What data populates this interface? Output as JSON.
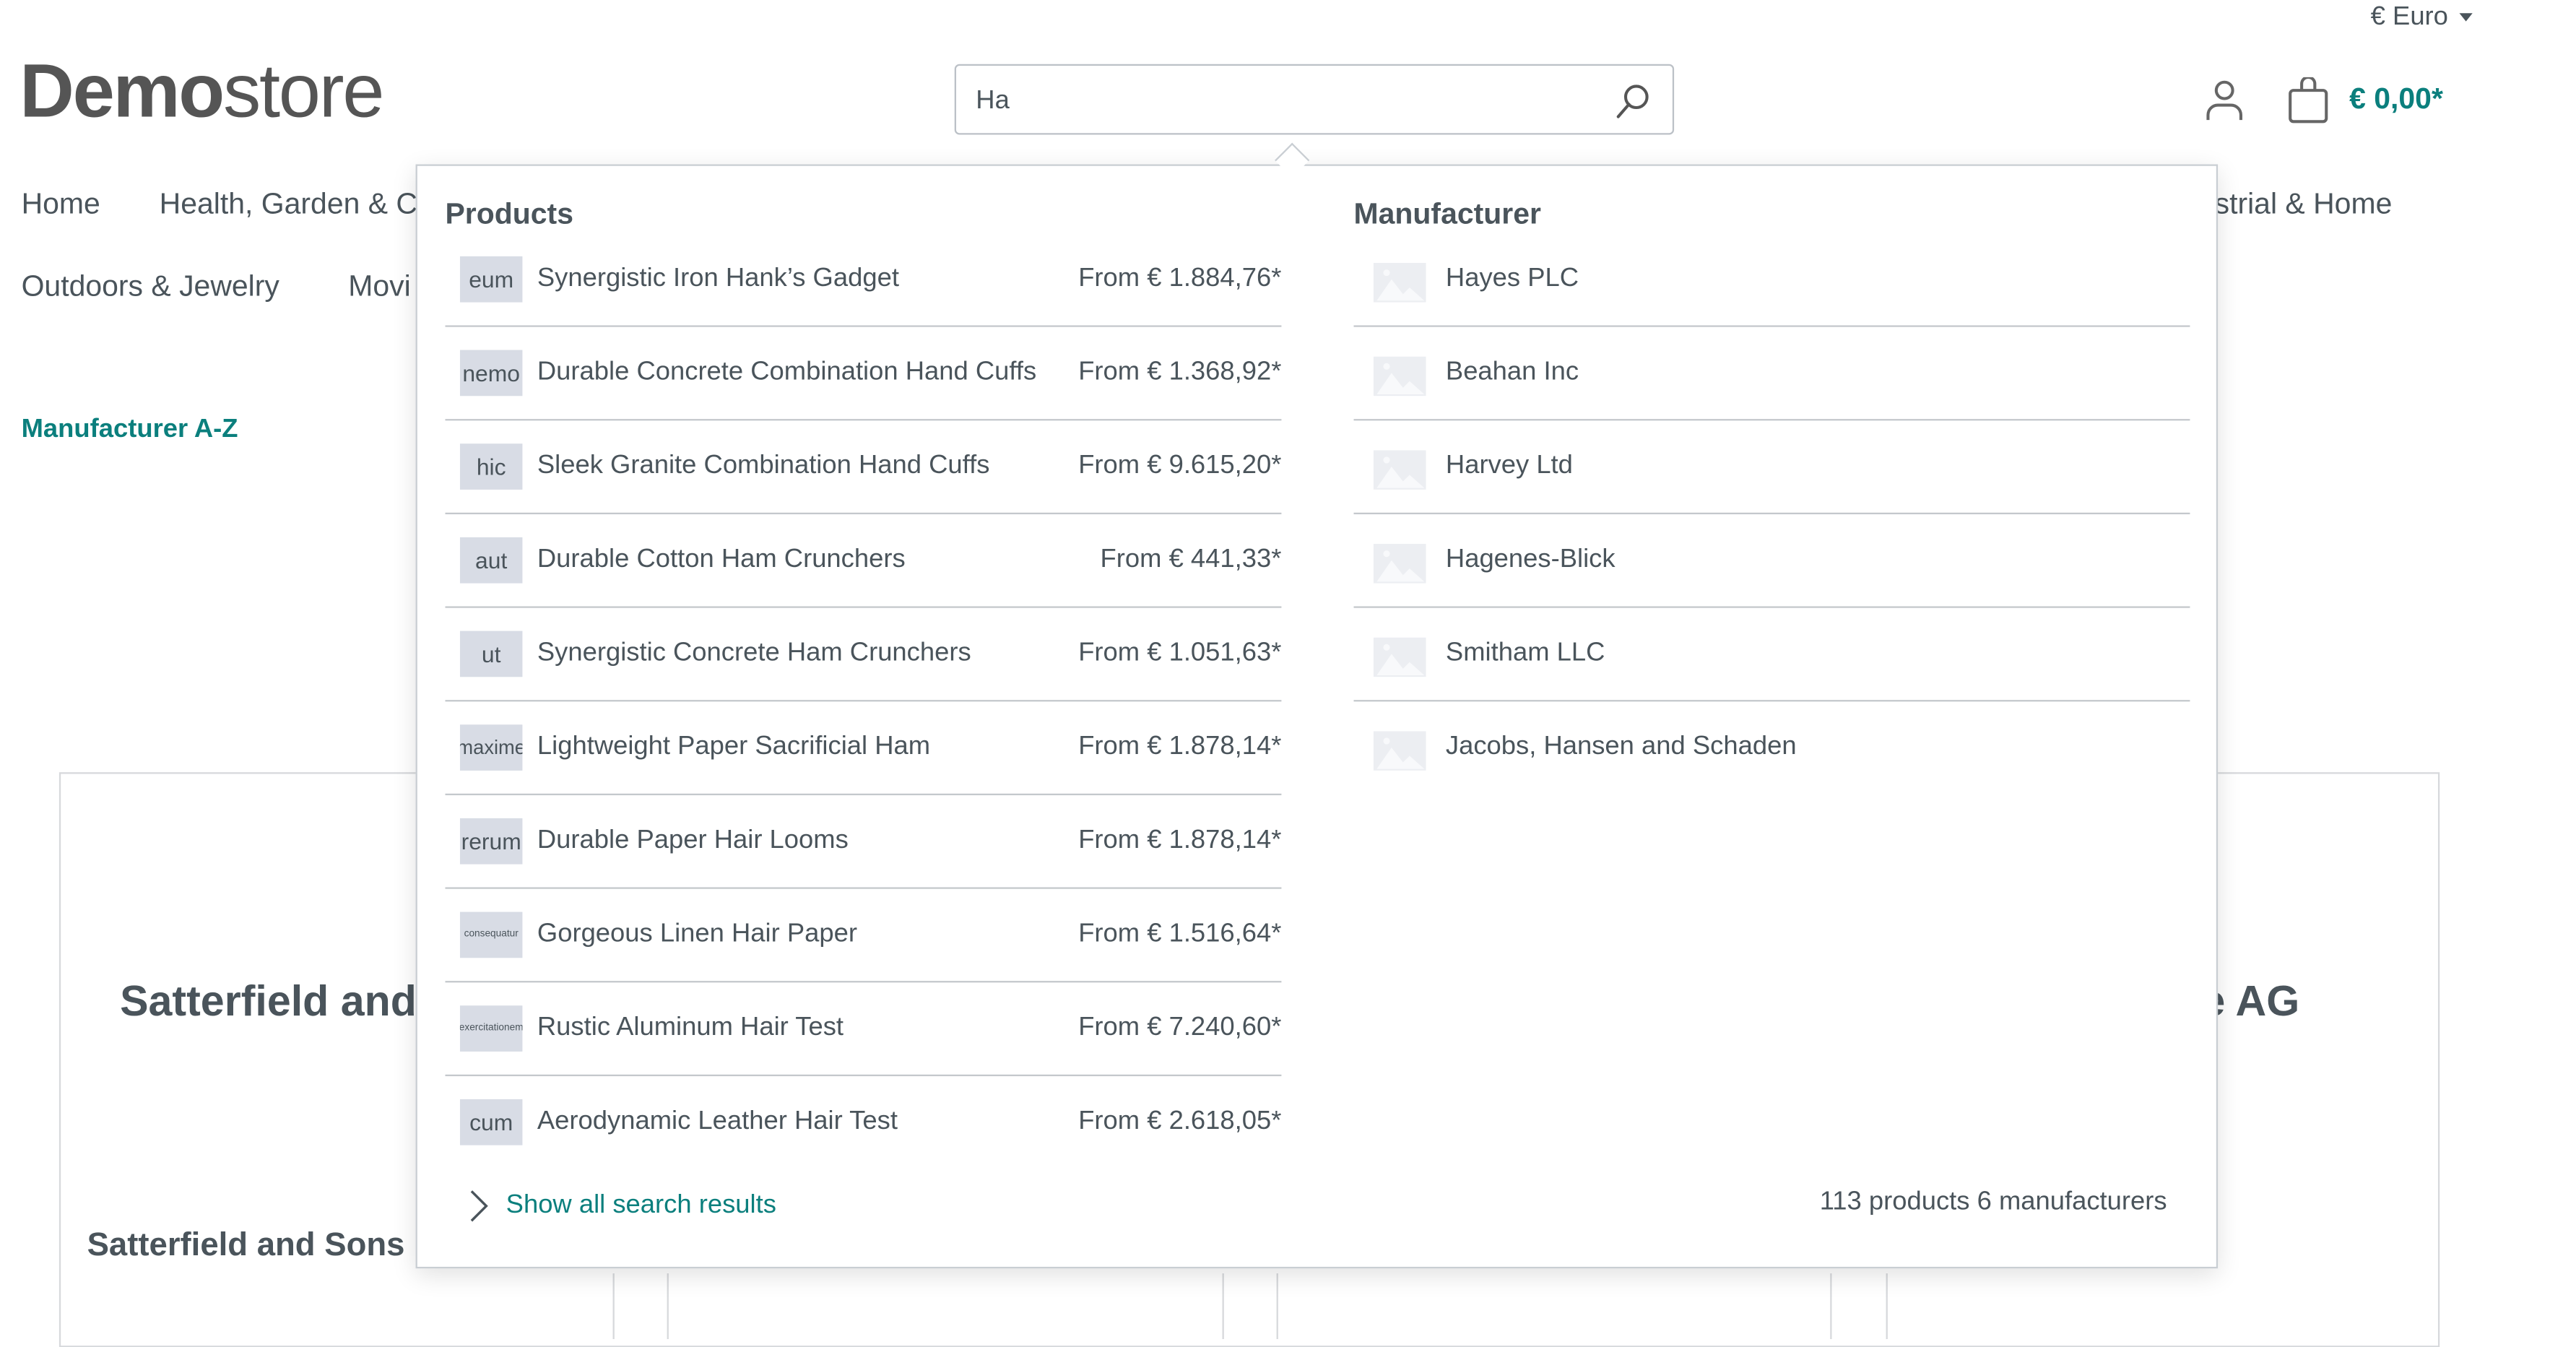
{
  "header": {
    "currency": "€ Euro",
    "logo_bold": "Demo",
    "logo_light": "store",
    "search": {
      "value": "Ha",
      "icon": "search-icon"
    },
    "cart_total": "€ 0,00*"
  },
  "nav": {
    "row1": [
      "Home",
      "Health, Garden & C",
      "ustrial & Home"
    ],
    "row2": [
      "Outdoors & Jewelry",
      "Movi"
    ]
  },
  "page": {
    "breadcrumb": "Manufacturer A-Z",
    "card_heading_left": "Satterfield and",
    "card_heading_right": "e AG",
    "card_subheading": "Satterfield and Sons"
  },
  "suggest": {
    "products_title": "Products",
    "manufacturer_title": "Manufacturer",
    "products": [
      {
        "thumb": "eum",
        "name": "Synergistic Iron Hank’s Gadget",
        "price": "From € 1.884,76*"
      },
      {
        "thumb": "nemo",
        "name": "Durable Concrete Combination Hand Cuffs",
        "price": "From € 1.368,92*"
      },
      {
        "thumb": "hic",
        "name": "Sleek Granite Combination Hand Cuffs",
        "price": "From € 9.615,20*"
      },
      {
        "thumb": "aut",
        "name": "Durable Cotton Ham Crunchers",
        "price": "From € 441,33*"
      },
      {
        "thumb": "ut",
        "name": "Synergistic Concrete Ham Crunchers",
        "price": "From € 1.051,63*"
      },
      {
        "thumb": "maxime",
        "name": "Lightweight Paper Sacrificial Ham",
        "price": "From € 1.878,14*"
      },
      {
        "thumb": "rerum",
        "name": "Durable Paper Hair Looms",
        "price": "From € 1.878,14*"
      },
      {
        "thumb": "consequatur",
        "name": "Gorgeous Linen Hair Paper",
        "price": "From € 1.516,64*"
      },
      {
        "thumb": "exercitationem",
        "name": "Rustic Aluminum Hair Test",
        "price": "From € 7.240,60*"
      },
      {
        "thumb": "cum",
        "name": "Aerodynamic Leather Hair Test",
        "price": "From € 2.618,05*"
      }
    ],
    "manufacturers": [
      "Hayes PLC",
      "Beahan Inc",
      "Harvey Ltd",
      "Hagenes-Blick",
      "Smitham LLC",
      "Jacobs, Hansen and Schaden"
    ],
    "show_all": "Show all search results",
    "counts": "113 products 6 manufacturers"
  },
  "colors": {
    "accent": "#0b7f7d",
    "text": "#4a545b",
    "thumb_bg": "#d8dce5"
  }
}
